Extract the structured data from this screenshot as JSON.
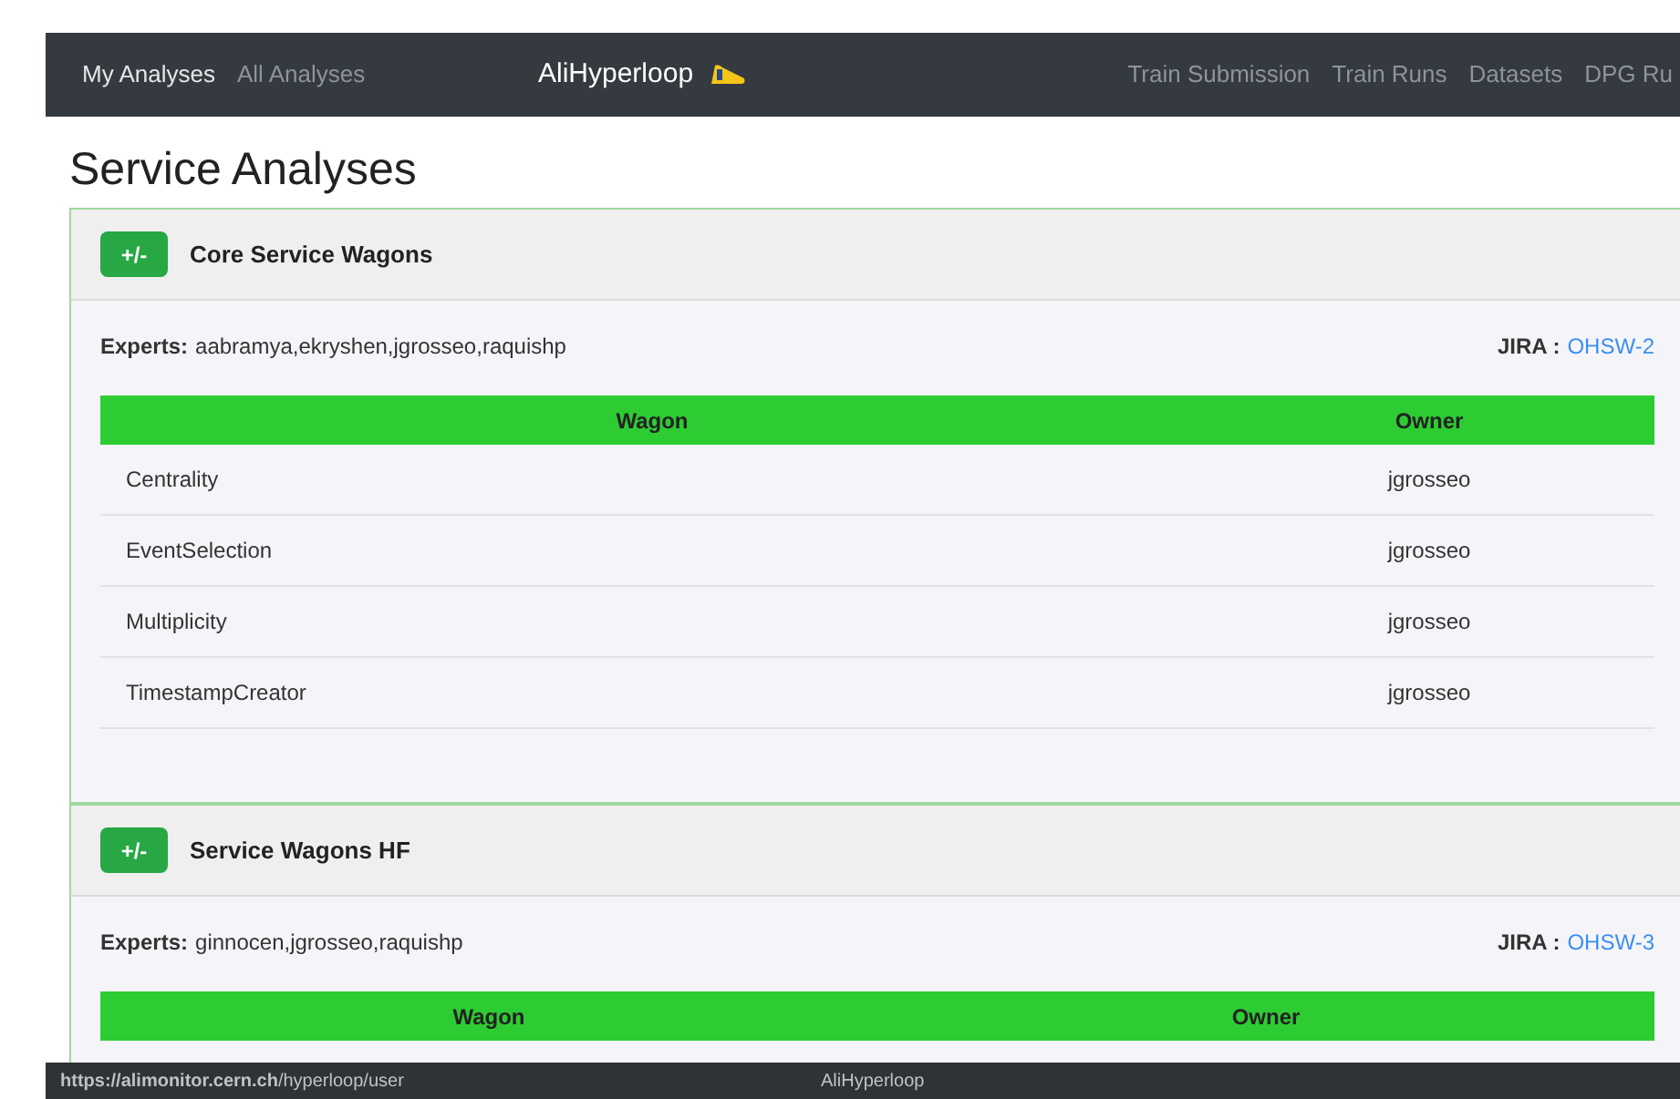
{
  "navbar": {
    "left_links": [
      {
        "label": "My Analyses",
        "selected": true
      },
      {
        "label": "All Analyses",
        "selected": false
      }
    ],
    "brand": "AliHyperloop",
    "right_links": [
      "Train Submission",
      "Train Runs",
      "Datasets",
      "DPG Ru"
    ]
  },
  "page_title": "Service Analyses",
  "sections": [
    {
      "toggle": "+/-",
      "title": "Core Service Wagons",
      "experts_label": "Experts:",
      "experts": "aabramya,ekryshen,jgrosseo,raquishp",
      "jira_label": "JIRA :",
      "jira": "OHSW-2",
      "columns": [
        "Wagon",
        "Owner"
      ],
      "rows": [
        [
          "Centrality",
          "jgrosseo"
        ],
        [
          "EventSelection",
          "jgrosseo"
        ],
        [
          "Multiplicity",
          "jgrosseo"
        ],
        [
          "TimestampCreator",
          "jgrosseo"
        ]
      ]
    },
    {
      "toggle": "+/-",
      "title": "Service Wagons HF",
      "experts_label": "Experts:",
      "experts": "ginnocen,jgrosseo,raquishp",
      "jira_label": "JIRA :",
      "jira": "OHSW-3",
      "columns": [
        "Wagon",
        "Owner"
      ]
    }
  ],
  "status_bar": {
    "url": "**https://alimonitor.cern.ch**/hyperloop/user",
    "title": "AliHyperloop"
  }
}
